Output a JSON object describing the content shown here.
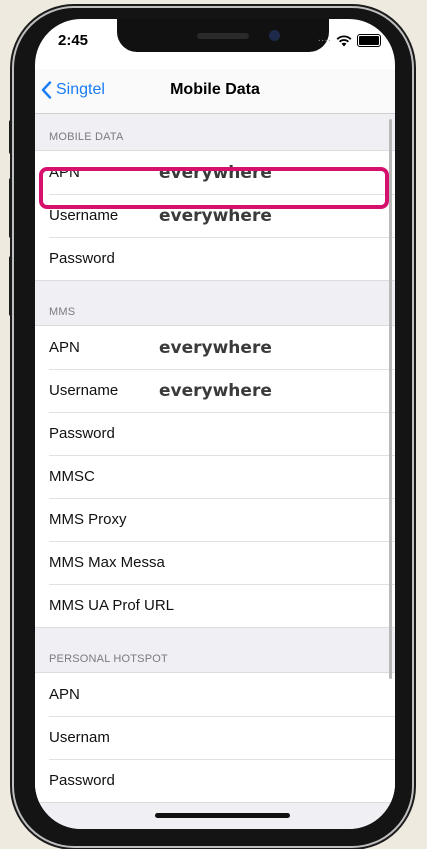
{
  "status_bar": {
    "time": "2:45",
    "signal_icon": "cell-dots-icon",
    "wifi_icon": "wifi-icon",
    "battery_icon": "battery-icon"
  },
  "navbar": {
    "back_label": "Singtel",
    "title": "Mobile Data",
    "back_icon": "chevron-left-icon"
  },
  "sections": [
    {
      "header": "MOBILE DATA",
      "rows": [
        {
          "label": "APN",
          "value": "everywhere"
        },
        {
          "label": "Username",
          "value": "everywhere"
        },
        {
          "label": "Password",
          "value": ""
        }
      ]
    },
    {
      "header": "MMS",
      "rows": [
        {
          "label": "APN",
          "value": "everywhere"
        },
        {
          "label": "Username",
          "value": "everywhere"
        },
        {
          "label": "Password",
          "value": ""
        },
        {
          "label": "MMSC",
          "value": ""
        },
        {
          "label": "MMS Proxy",
          "value": ""
        },
        {
          "label": "MMS Max Messa",
          "value": ""
        },
        {
          "label": "MMS UA Prof URL",
          "value": ""
        }
      ]
    },
    {
      "header": "PERSONAL HOTSPOT",
      "rows": [
        {
          "label": "APN",
          "value": ""
        },
        {
          "label": "Usernam",
          "value": ""
        },
        {
          "label": "Password",
          "value": ""
        }
      ]
    }
  ],
  "colors": {
    "accent": "#1a7cf5",
    "highlight": "#d6116d",
    "background": "#efeadf"
  }
}
